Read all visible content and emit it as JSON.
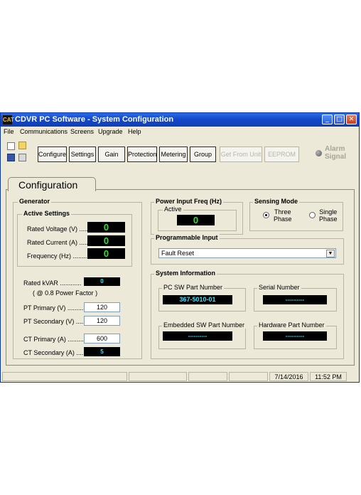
{
  "window": {
    "title": "CDVR PC Software - System Configuration",
    "logo_text": "CAT"
  },
  "menu": [
    "File",
    "Communications",
    "Screens",
    "Upgrade",
    "Help"
  ],
  "toolbar": {
    "buttons": [
      "Configure",
      "Settings",
      "Gain",
      "Protection",
      "Metering",
      "Group"
    ],
    "get_from_unit": "Get From Unit",
    "eeprom": "EEPROM",
    "alarm_line1": "Alarm",
    "alarm_line2": "Signal"
  },
  "tab": {
    "label": "Configuration"
  },
  "generator": {
    "title": "Generator",
    "active_settings": {
      "title": "Active Settings",
      "rated_voltage_label": "Rated Voltage (V) .....",
      "rated_voltage": "0",
      "rated_current_label": "Rated Current (A) .....",
      "rated_current": "0",
      "frequency_label": "Frequency (Hz) .........",
      "frequency": "0"
    },
    "rated_kvar_label": "Rated kVAR ............",
    "rated_kvar": "0",
    "power_factor_note": "( @ 0.8 Power Factor )",
    "pt_primary_label": "PT Primary (V) ..........",
    "pt_primary": "120",
    "pt_secondary_label": "PT Secondary (V) .....",
    "pt_secondary": "120",
    "ct_primary_label": "CT Primary (A) .........",
    "ct_primary": "600",
    "ct_secondary_label": "CT Secondary (A) .....",
    "ct_secondary": "5"
  },
  "power_input": {
    "title": "Power Input Freq (Hz)",
    "active_label": "Active",
    "value": "0"
  },
  "sensing_mode": {
    "title": "Sensing Mode",
    "three_line1": "Three",
    "three_line2": "Phase",
    "single_line1": "Single",
    "single_line2": "Phase",
    "selected": "three"
  },
  "programmable_input": {
    "title": "Programmable Input",
    "selected": "Fault Reset"
  },
  "system_information": {
    "title": "System Information",
    "pc_sw_label": "PC SW Part Number",
    "pc_sw_value": "367-5010-01",
    "serial_label": "Serial Number",
    "serial_value": "----------",
    "embedded_label": "Embedded SW Part Number",
    "embedded_value": "----------",
    "hardware_label": "Hardware Part Number",
    "hardware_value": "----------"
  },
  "status": {
    "date": "7/14/2016",
    "time": "11:52 PM"
  }
}
